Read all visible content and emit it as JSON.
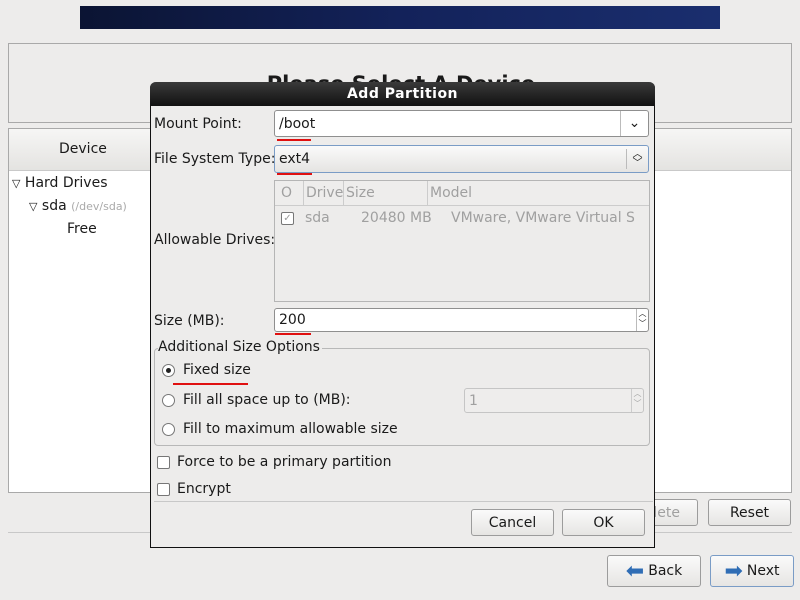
{
  "page": {
    "heading": "Please Select A Device",
    "device_column": "Device"
  },
  "tree": {
    "hard_drives": "Hard Drives",
    "sda": "sda",
    "sda_path": "(/dev/sda)",
    "free": "Free"
  },
  "buttons": {
    "delete": "Delete",
    "delete_visible": "lete",
    "reset": "Reset",
    "back": "Back",
    "next": "Next"
  },
  "dialog": {
    "title": "Add Partition",
    "mount_point_label": "Mount Point:",
    "mount_point_value": "/boot",
    "fs_type_label": "File System Type:",
    "fs_type_value": "ext4",
    "allowable_drives_label": "Allowable Drives:",
    "drives_columns": [
      "O",
      "Drive",
      "Size",
      "Model"
    ],
    "drives": [
      {
        "checked": true,
        "drive": "sda",
        "size": "20480 MB",
        "model": "VMware, VMware Virtual S"
      }
    ],
    "size_label": "Size (MB):",
    "size_value": "200",
    "size_options_label": "Additional Size Options",
    "fixed_size": "Fixed size",
    "fill_up_to": "Fill all space up to (MB):",
    "fill_up_to_value": "1",
    "fill_max": "Fill to maximum allowable size",
    "selected_size_option": "Fixed size",
    "force_primary": "Force to be a primary partition",
    "force_primary_checked": false,
    "encrypt": "Encrypt",
    "encrypt_checked": false,
    "cancel": "Cancel",
    "ok": "OK"
  },
  "colors": {
    "annotation_underline": "#e01010",
    "arrow": "#2f6db5"
  }
}
